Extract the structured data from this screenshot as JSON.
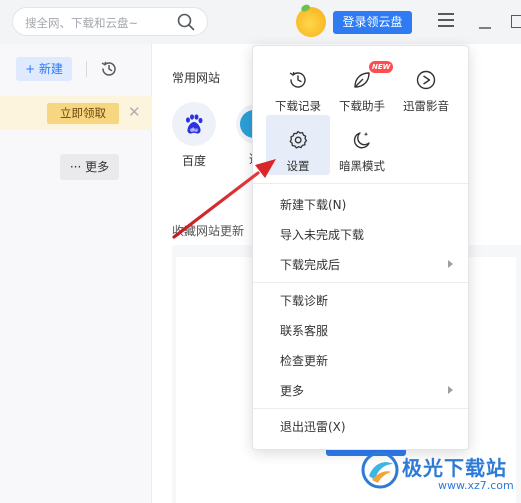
{
  "colors": {
    "accent": "#2e7bf3",
    "promo_bg": "#fdf4dd",
    "promo_button": "#f6d680",
    "badge": "#ff4d4f",
    "annotation_arrow": "#d9262a",
    "watermark": "#2d7bd6"
  },
  "header": {
    "search_placeholder": "搜全网、下载和云盘~",
    "search_icon": "search-icon",
    "login_button": "登录领云盘",
    "menu_icon": "hamburger-menu-icon",
    "window_controls": [
      "minimize-icon",
      "maximize-icon"
    ]
  },
  "sidebar": {
    "new_button": "+ 新建",
    "history_icon": "history-icon",
    "promo_button": "立即领取",
    "promo_close": "✕",
    "more_button": "··· 更多"
  },
  "main": {
    "common_sites_title": "常用网站",
    "sites": [
      {
        "label": "百度",
        "icon": "baidu-icon"
      },
      {
        "label": "迅",
        "icon": "site-icon"
      }
    ],
    "favorites_title": "收藏网站更新（"
  },
  "dropdown": {
    "grid": [
      {
        "label": "下载记录",
        "icon": "history-icon"
      },
      {
        "label": "下载助手",
        "icon": "download-assistant-icon",
        "badge": "NEW"
      },
      {
        "label": "迅雷影音",
        "icon": "play-circle-icon"
      },
      {
        "label": "设置",
        "icon": "gear-icon",
        "active": true
      },
      {
        "label": "暗黑模式",
        "icon": "moon-icon"
      }
    ],
    "menu_groups": [
      [
        {
          "label": "新建下载(N)"
        },
        {
          "label": "导入未完成下载"
        },
        {
          "label": "下载完成后",
          "submenu": true
        }
      ],
      [
        {
          "label": "下载诊断"
        },
        {
          "label": "联系客服"
        },
        {
          "label": "检查更新"
        },
        {
          "label": "更多",
          "submenu": true
        }
      ],
      [
        {
          "label": "退出迅雷(X)"
        }
      ]
    ]
  },
  "watermark": {
    "brand": "极光下载站",
    "url": "www.xz7.com"
  }
}
